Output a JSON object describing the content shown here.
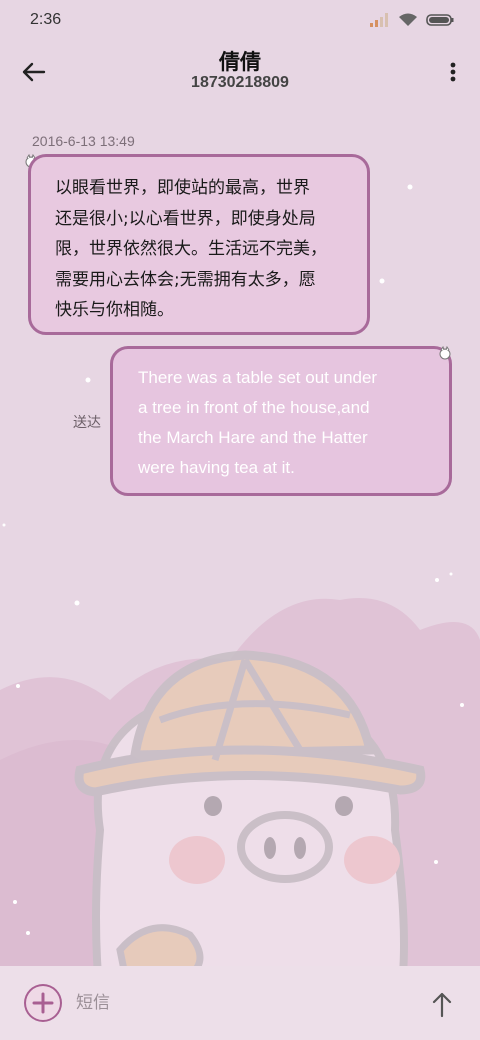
{
  "status_bar": {
    "time": "2:36",
    "icons": [
      "signal-icon",
      "wifi-icon",
      "battery-icon"
    ]
  },
  "header": {
    "contact_name": "倩倩",
    "phone_number": "18730218809",
    "back_icon": "arrow-left-icon",
    "menu_icon": "more-vert-icon"
  },
  "conversation": {
    "timestamp": "2016-6-13 13:49",
    "incoming_message": {
      "lines": [
        "以眼看世界，即使站的最高，世界",
        "还是很小;以心看世界，即使身处局",
        "限，世界依然很大。生活远不完美，",
        "需要用心去体会;无需拥有太多，愿",
        "快乐与你相随。"
      ]
    },
    "outgoing_message": {
      "lines": [
        "There was a table set out under",
        "a tree in front of the house,and",
        "the March Hare and the Hatter",
        "were having tea at it."
      ],
      "status": "送达"
    }
  },
  "composer": {
    "placeholder": "短信",
    "add_icon": "add-icon",
    "send_icon": "arrow-up-icon"
  },
  "colors": {
    "background": "#e7d6e3",
    "bubble_border": "#a86a9a",
    "incoming_bubble": "#e8c9e0",
    "outgoing_bubble": "#e6c5df",
    "accent": "#a85f92"
  }
}
